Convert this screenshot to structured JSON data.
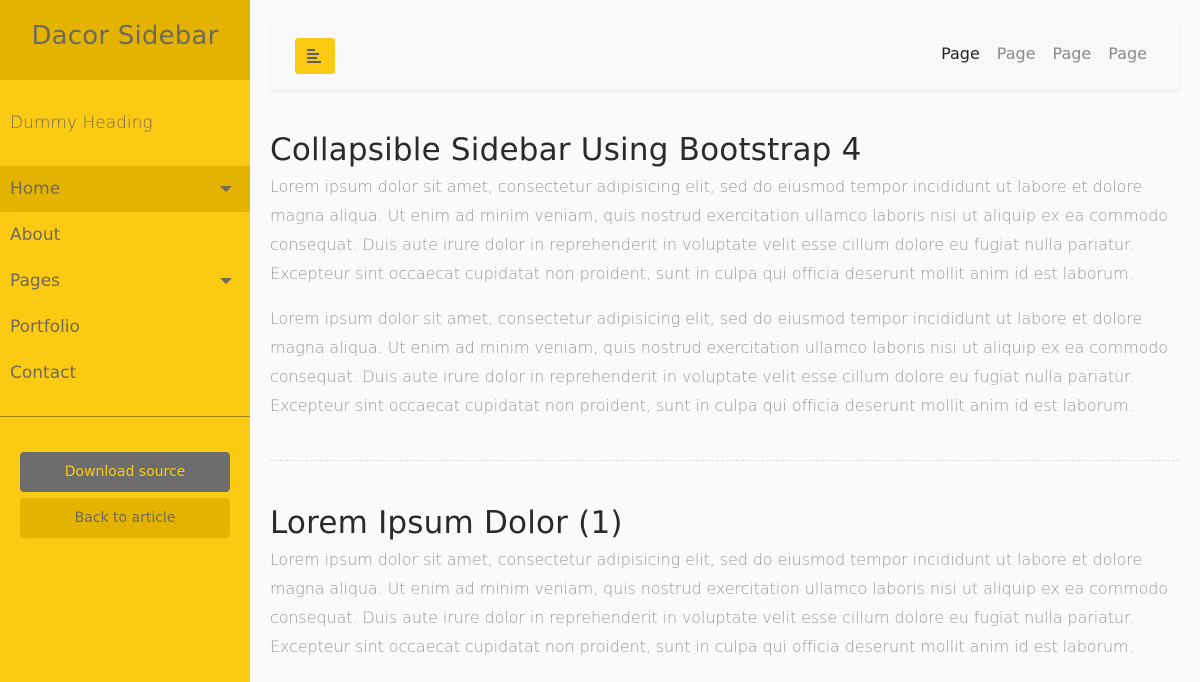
{
  "sidebar": {
    "brand": "Dacor Sidebar",
    "dummy_heading": "Dummy Heading",
    "items": [
      {
        "label": "Home",
        "has_submenu": true,
        "active": true
      },
      {
        "label": "About",
        "has_submenu": false,
        "active": false
      },
      {
        "label": "Pages",
        "has_submenu": true,
        "active": false
      },
      {
        "label": "Portfolio",
        "has_submenu": false,
        "active": false
      },
      {
        "label": "Contact",
        "has_submenu": false,
        "active": false
      }
    ],
    "download_label": "Download source",
    "back_label": "Back to article"
  },
  "navbar": {
    "links": [
      "Page",
      "Page",
      "Page",
      "Page"
    ]
  },
  "sections": [
    {
      "title": "Collapsible Sidebar Using Bootstrap 4",
      "paragraphs": [
        "Lorem ipsum dolor sit amet, consectetur adipisicing elit, sed do eiusmod tempor incididunt ut labore et dolore magna aliqua. Ut enim ad minim veniam, quis nostrud exercitation ullamco laboris nisi ut aliquip ex ea commodo consequat. Duis aute irure dolor in reprehenderit in voluptate velit esse cillum dolore eu fugiat nulla pariatur. Excepteur sint occaecat cupidatat non proident, sunt in culpa qui officia deserunt mollit anim id est laborum.",
        "Lorem ipsum dolor sit amet, consectetur adipisicing elit, sed do eiusmod tempor incididunt ut labore et dolore magna aliqua. Ut enim ad minim veniam, quis nostrud exercitation ullamco laboris nisi ut aliquip ex ea commodo consequat. Duis aute irure dolor in reprehenderit in voluptate velit esse cillum dolore eu fugiat nulla pariatur. Excepteur sint occaecat cupidatat non proident, sunt in culpa qui officia deserunt mollit anim id est laborum."
      ]
    },
    {
      "title": "Lorem Ipsum Dolor (1)",
      "paragraphs": [
        "Lorem ipsum dolor sit amet, consectetur adipisicing elit, sed do eiusmod tempor incididunt ut labore et dolore magna aliqua. Ut enim ad minim veniam, quis nostrud exercitation ullamco laboris nisi ut aliquip ex ea commodo consequat. Duis aute irure dolor in reprehenderit in voluptate velit esse cillum dolore eu fugiat nulla pariatur. Excepteur sint occaecat cupidatat non proident, sunt in culpa qui officia deserunt mollit anim id est laborum."
      ]
    }
  ],
  "colors": {
    "accent": "#fdca13",
    "accent_dark": "#e3b300",
    "download_bg": "#6d6d6d"
  }
}
